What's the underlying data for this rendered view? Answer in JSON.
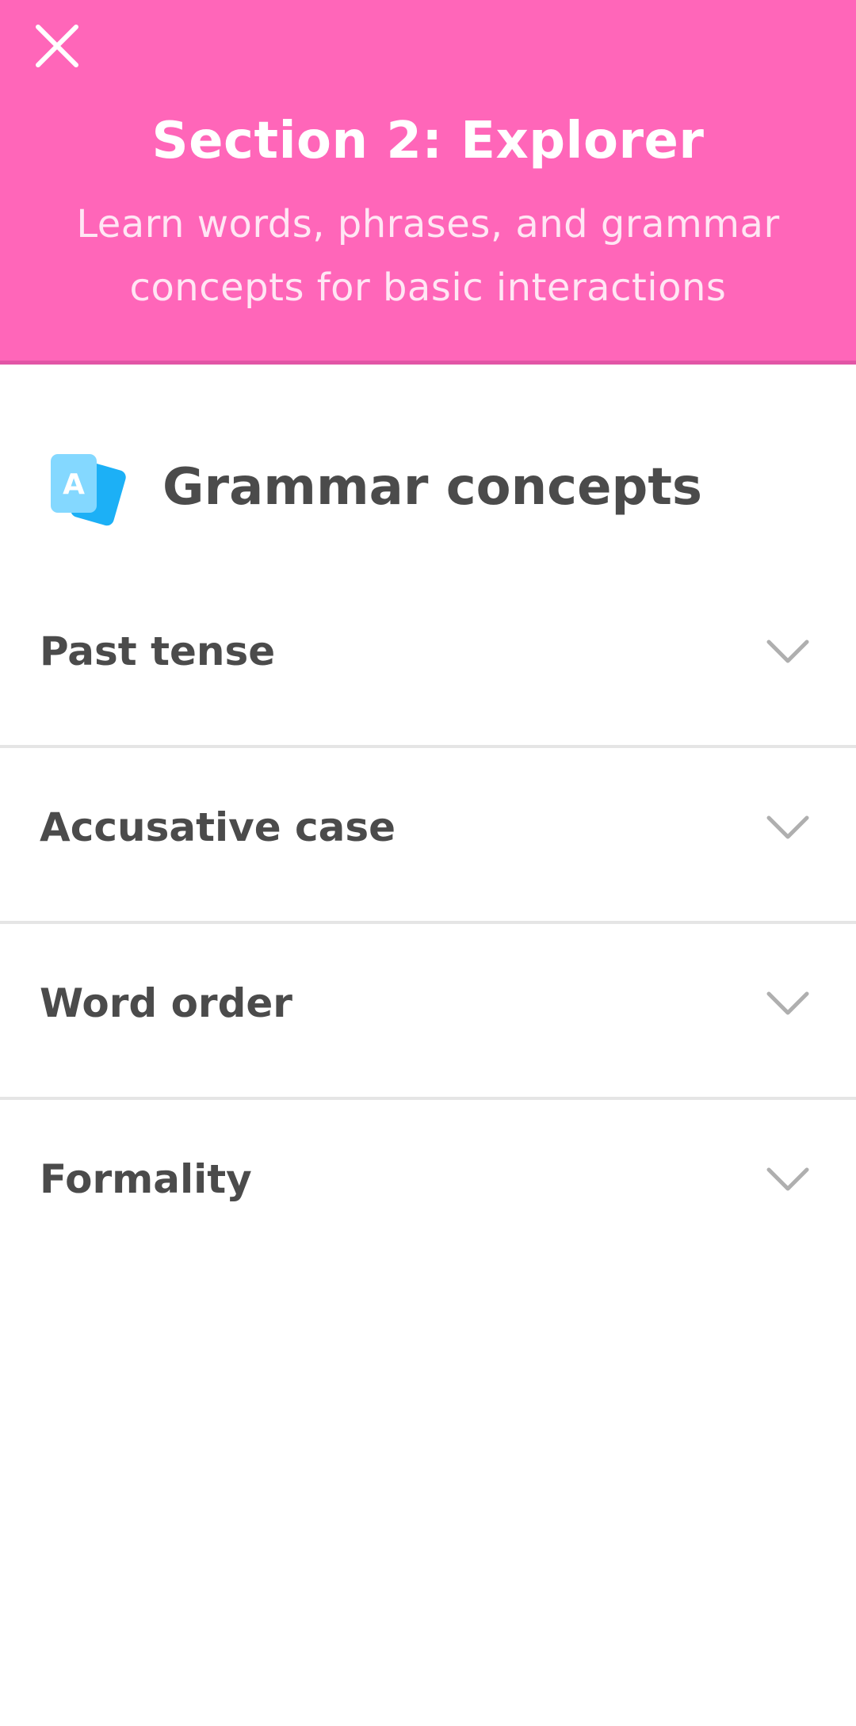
{
  "header": {
    "close_icon": "close-icon",
    "title": "Section 2: Explorer",
    "subtitle": "Learn words, phrases, and grammar concepts for basic interactions",
    "background_color": "#ff66b9"
  },
  "concepts": {
    "icon": "flashcards-icon",
    "title": "Grammar concepts",
    "items": [
      {
        "label": "Past tense",
        "icon": "chevron-down-icon"
      },
      {
        "label": "Accusative case",
        "icon": "chevron-down-icon"
      },
      {
        "label": "Word order",
        "icon": "chevron-down-icon"
      },
      {
        "label": "Formality",
        "icon": "chevron-down-icon"
      }
    ]
  },
  "colors": {
    "accent": "#ff66b9",
    "text": "#4b4b4b",
    "divider": "#e5e5e5",
    "chevron": "#afafaf"
  }
}
